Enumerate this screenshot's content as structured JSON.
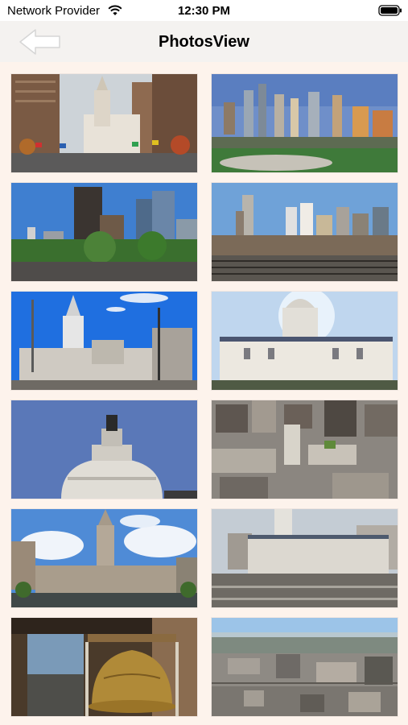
{
  "status_bar": {
    "carrier": "Network Provider",
    "time": "12:30 PM",
    "icons": [
      "wifi-icon",
      "battery-icon"
    ]
  },
  "nav": {
    "title": "PhotosView",
    "back_icon": "back-arrow-icon"
  },
  "photos": [
    {
      "name": "photo-city-hall-avenue-flags"
    },
    {
      "name": "photo-skyline-stadium"
    },
    {
      "name": "photo-downtown-towers-park"
    },
    {
      "name": "photo-skyline-rail-yard"
    },
    {
      "name": "photo-city-hall-tower-blue-sky"
    },
    {
      "name": "photo-city-hall-facade"
    },
    {
      "name": "photo-dome-closeup"
    },
    {
      "name": "photo-aerial-city-hall"
    },
    {
      "name": "photo-city-hall-clouds"
    },
    {
      "name": "photo-city-hall-plaza"
    },
    {
      "name": "photo-liberty-bell"
    },
    {
      "name": "photo-aerial-city-panorama"
    }
  ]
}
